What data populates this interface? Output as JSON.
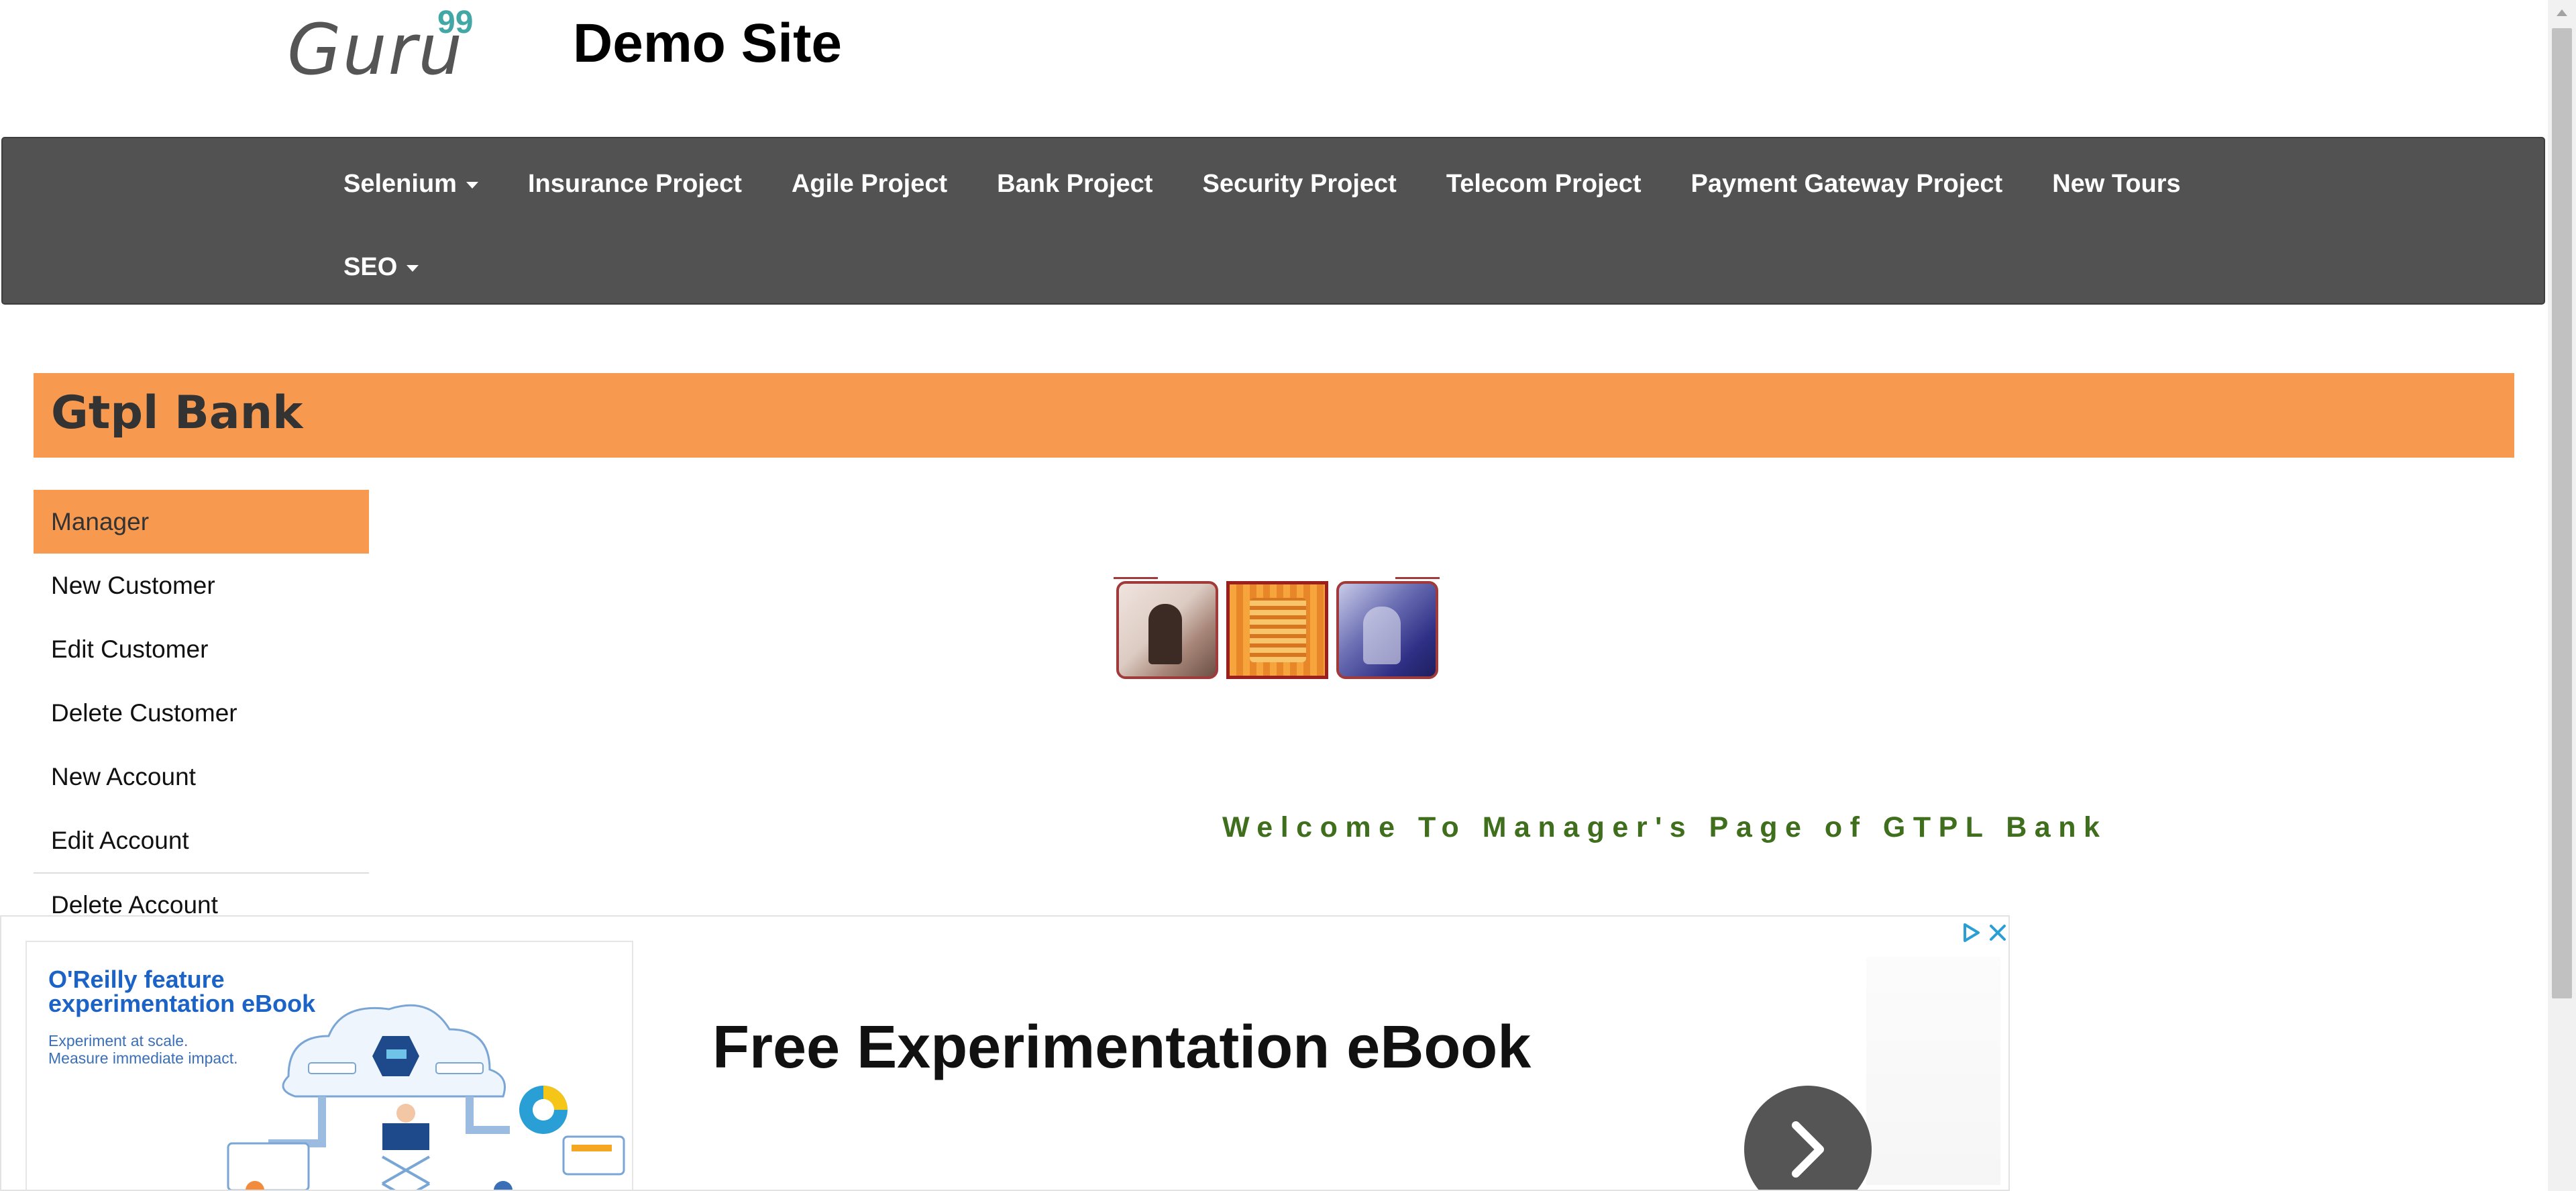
{
  "header": {
    "logo_text": "Guru",
    "logo_superscript": "99",
    "site_title": "Demo Site"
  },
  "navbar": {
    "items_row1": [
      {
        "label": "Selenium",
        "dropdown": true
      },
      {
        "label": "Insurance Project",
        "dropdown": false
      },
      {
        "label": "Agile Project",
        "dropdown": false
      },
      {
        "label": "Bank Project",
        "dropdown": false
      },
      {
        "label": "Security Project",
        "dropdown": false
      },
      {
        "label": "Telecom Project",
        "dropdown": false
      },
      {
        "label": "Payment Gateway Project",
        "dropdown": false
      },
      {
        "label": "New Tours",
        "dropdown": false
      }
    ],
    "items_row2": [
      {
        "label": "SEO",
        "dropdown": true
      }
    ],
    "background_color": "#525252"
  },
  "bank": {
    "title": "Gtpl Bank",
    "accent_color": "#f79a50"
  },
  "sidebar": {
    "items": [
      {
        "label": "Manager",
        "active": true
      },
      {
        "label": "New Customer",
        "active": false
      },
      {
        "label": "Edit Customer",
        "active": false
      },
      {
        "label": "Delete Customer",
        "active": false
      },
      {
        "label": "New Account",
        "active": false
      },
      {
        "label": "Edit Account",
        "active": false
      },
      {
        "label": "Delete Account",
        "active": false
      }
    ]
  },
  "main": {
    "welcome_text": "Welcome To Manager's Page of GTPL Bank",
    "welcome_color": "#3f6f1d"
  },
  "ad": {
    "image_title": "O'Reilly feature experimentation eBook",
    "image_subtitle_line1": "Experiment at scale.",
    "image_subtitle_line2": "Measure immediate impact.",
    "headline": "Free Experimentation eBook",
    "cta_icon": "chevron-right-icon",
    "choices_icon": "adchoices-icon",
    "close_icon": "close-icon"
  }
}
